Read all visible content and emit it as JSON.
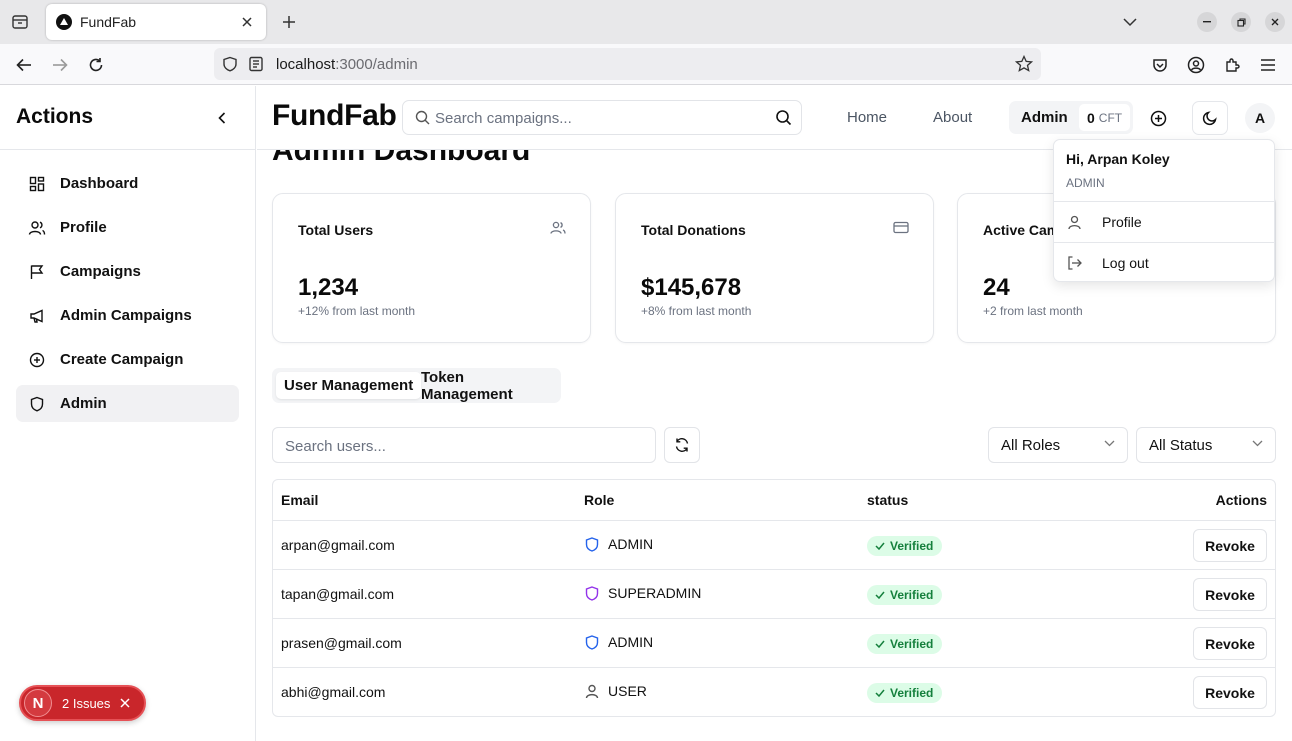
{
  "browser": {
    "tab_title": "FundFab",
    "url_host": "localhost",
    "url_path": ":3000/admin"
  },
  "sidebar": {
    "title": "Actions",
    "items": [
      {
        "label": "Dashboard",
        "icon": "dashboard-icon"
      },
      {
        "label": "Profile",
        "icon": "users-icon"
      },
      {
        "label": "Campaigns",
        "icon": "flag-icon"
      },
      {
        "label": "Admin Campaigns",
        "icon": "megaphone-icon"
      },
      {
        "label": "Create Campaign",
        "icon": "plus-circle-icon"
      },
      {
        "label": "Admin",
        "icon": "shield-icon",
        "active": true
      }
    ]
  },
  "header": {
    "brand": "FundFab",
    "search_placeholder": "Search campaigns...",
    "nav": [
      "Home",
      "About"
    ],
    "admin_label": "Admin",
    "token_count": "0",
    "token_unit": "CFT",
    "avatar_initial": "A"
  },
  "user_menu": {
    "greeting": "Hi, Arpan Koley",
    "role": "ADMIN",
    "items": [
      "Profile",
      "Log out"
    ]
  },
  "main": {
    "title": "Admin Dashboard",
    "stats": [
      {
        "title": "Total Users",
        "value": "1,234",
        "sub": "+12% from last month",
        "icon": "users-icon"
      },
      {
        "title": "Total Donations",
        "value": "$145,678",
        "sub": "+8% from last month",
        "icon": "credit-card-icon"
      },
      {
        "title": "Active Cam",
        "value": "24",
        "sub": "+2 from last month",
        "icon": "campaign-icon"
      }
    ],
    "tabs": [
      "User Management",
      "Token Management"
    ],
    "user_search_placeholder": "Search users...",
    "filters": [
      "All Roles",
      "All Status"
    ],
    "table": {
      "columns": [
        "Email",
        "Role",
        "status",
        "Actions"
      ],
      "rows": [
        {
          "email": "arpan@gmail.com",
          "role": "ADMIN",
          "status": "Verified",
          "action": "Revoke"
        },
        {
          "email": "tapan@gmail.com",
          "role": "SUPERADMIN",
          "status": "Verified",
          "action": "Revoke"
        },
        {
          "email": "prasen@gmail.com",
          "role": "ADMIN",
          "status": "Verified",
          "action": "Revoke"
        },
        {
          "email": "abhi@gmail.com",
          "role": "USER",
          "status": "Verified",
          "action": "Revoke"
        }
      ]
    }
  },
  "issues_toast": {
    "badge": "N",
    "label": "2 Issues"
  },
  "colors": {
    "admin_role": "#2563eb",
    "superadmin_role": "#9333ea",
    "verified_bg": "#dcfce7",
    "verified_text": "#15803d",
    "issues_bg": "#c9262b"
  }
}
